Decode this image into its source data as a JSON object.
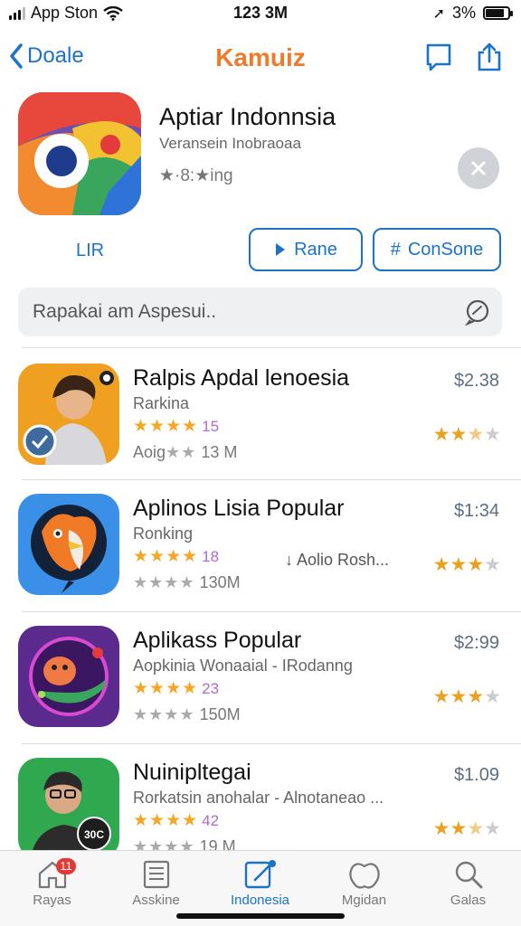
{
  "status_bar": {
    "carrier": "App Ston",
    "time": "123 3M",
    "battery": "3%"
  },
  "nav": {
    "back_label": "Doale",
    "title": "Kamuiz",
    "title_color": "#f07a2a"
  },
  "app": {
    "title": "Aptiar Indonnsia",
    "subtitle": "Veransein Inobraoaa",
    "rating_text": "★·8:★ing",
    "link_label": "LIR",
    "button_rane": "Rane",
    "button_cons": "ConSone"
  },
  "search": {
    "placeholder": "Rapakai am Aspesui.."
  },
  "list": [
    {
      "title": "Ralpis Apdal lenoesia",
      "subtitle": "Rarkina",
      "stars": "★★★★",
      "count": "15",
      "size_prefix": "Aoig",
      "size_stars": "★★",
      "size": "13 M",
      "extra": "",
      "price": "$2.38",
      "rating": 2.5
    },
    {
      "title": "Aplinos Lisia Popular",
      "subtitle": "Ronking",
      "stars": "★★★★",
      "count": "18",
      "size_prefix": "",
      "size_stars": "★★★★",
      "size": "130M",
      "extra": "↓ Aolio Rosh...",
      "price": "$1:34",
      "rating": 3
    },
    {
      "title": "Aplikass Popular",
      "subtitle": "Aopkinia Wonaaial - IRodanng",
      "stars": "★★★★",
      "count": "23",
      "size_prefix": "",
      "size_stars": "★★★★",
      "size": "150M",
      "extra": "",
      "price": "$2:99",
      "rating": 3
    },
    {
      "title": "Nuinipltegai",
      "subtitle": "Rorkatsin anohalar - Alnotaneao ...",
      "stars": "★★★★",
      "count": "42",
      "size_prefix": "",
      "size_stars": "★★★★",
      "size": "19 M",
      "extra": "",
      "price": "$1.09",
      "rating": 2.5
    }
  ],
  "tabs": [
    {
      "label": "Rayas",
      "icon": "home-icon",
      "badge": "11"
    },
    {
      "label": "Asskine",
      "icon": "news-icon"
    },
    {
      "label": "Indonesia",
      "icon": "edit-icon",
      "active": true
    },
    {
      "label": "Mgidan",
      "icon": "apple-icon"
    },
    {
      "label": "Galas",
      "icon": "search-icon"
    }
  ],
  "colors": {
    "accent": "#1a73c7",
    "star": "#e8a21f"
  }
}
